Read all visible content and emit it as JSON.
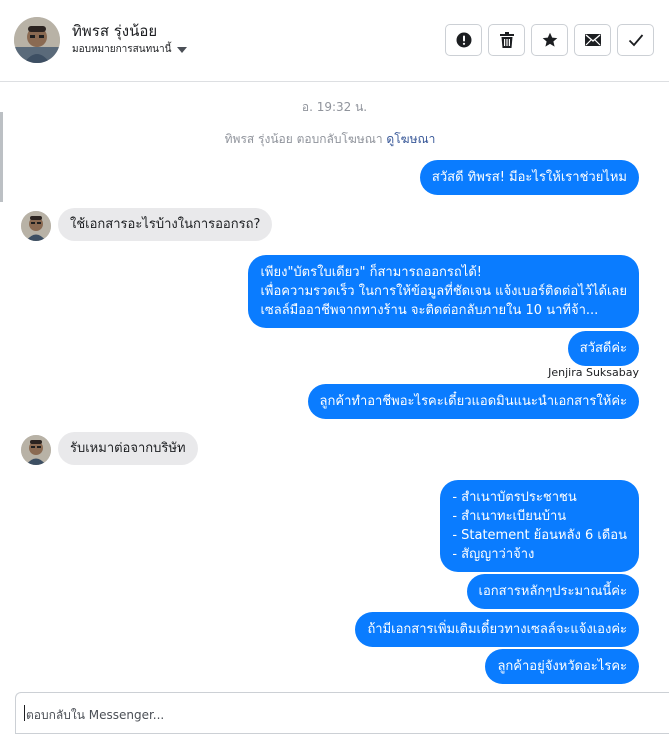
{
  "header": {
    "name": "ทิพรส รุ่งน้อย",
    "assign_label": "มอบหมายการสนทนานี้",
    "actions": [
      {
        "name": "report",
        "icon": "exclamation-icon"
      },
      {
        "name": "delete",
        "icon": "trash-icon"
      },
      {
        "name": "star",
        "icon": "star-icon"
      },
      {
        "name": "mark-unread",
        "icon": "envelope-icon"
      },
      {
        "name": "mark-done",
        "icon": "checkmark-icon"
      }
    ]
  },
  "conversation": {
    "timestamp": "อ. 19:32 น.",
    "system_note": {
      "text": "ทิพรส รุ่งน้อย ตอบกลับโฆษณา",
      "link": "ดูโฆษณา"
    },
    "messages": [
      {
        "from": "page",
        "lines": [
          "สวัสดี ทิพรส! มีอะไรให้เราช่วยไหม"
        ]
      },
      {
        "from": "user",
        "lines": [
          "ใช้เอกสารอะไรบ้างในการออกรถ?"
        ]
      },
      {
        "from": "page",
        "lines": [
          "เพียง\"บัตรใบเดียว\" ก็สามารถออกรถได้!",
          "เพื่อความรวดเร็ว ในการให้ข้อมูลที่ชัดเจน แจ้งเบอร์ติดต่อไว้ได้เลย",
          "เซลล์มืออาชีพจากทางร้าน จะติดต่อกลับภายใน 10 นาทีจ้า..."
        ]
      },
      {
        "from": "page",
        "lines": [
          "สวัสดีค่ะ"
        ],
        "sender": "Jenjira Suksabay"
      },
      {
        "from": "page",
        "lines": [
          "ลูกค้าทำอาชีพอะไรคะเดี๋ยวแอดมินแนะนำเอกสารให้ค่ะ"
        ]
      },
      {
        "from": "user",
        "lines": [
          "รับเหมาต่อจากบริษัท"
        ]
      },
      {
        "from": "page",
        "lines": [
          "- สำเนาบัตรประชาชน",
          "- สำเนาทะเบียนบ้าน",
          "- Statement ย้อนหลัง 6 เดือน",
          "- สัญญาว่าจ้าง"
        ]
      },
      {
        "from": "page",
        "lines": [
          "เอกสารหลักๆประมาณนี้ค่ะ"
        ]
      },
      {
        "from": "page",
        "lines": [
          "ถ้ามีเอกสารเพิ่มเติมเดี๋ยวทางเซลล์จะแจ้งเองค่ะ"
        ]
      },
      {
        "from": "page",
        "lines": [
          "ลูกค้าอยู่จังหวัดอะไรคะ"
        ]
      }
    ]
  },
  "composer": {
    "placeholder": "ตอบกลับใน Messenger..."
  },
  "colors": {
    "outgoing_bubble": "#0a7cff",
    "incoming_bubble": "#e9e9eb",
    "link": "#385898"
  }
}
